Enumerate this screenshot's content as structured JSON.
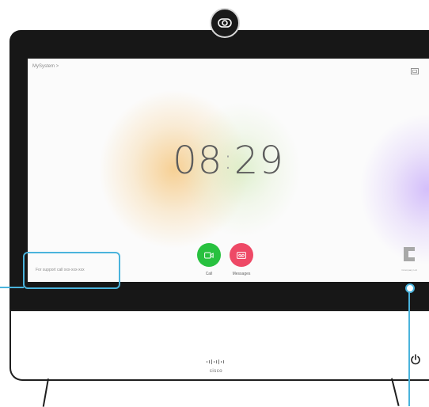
{
  "device": {
    "breadcrumb": "MySystem >",
    "clock": {
      "hours": "08",
      "separator": ":",
      "minutes": "29"
    },
    "support_text": "For support call xxx-xxx-xxx",
    "actions": [
      {
        "label": "Call",
        "icon": "video-camera-icon",
        "color": "#28c13f"
      },
      {
        "label": "Messages",
        "icon": "voicemail-icon",
        "color": "#ee4966"
      }
    ],
    "brand_caption": "Ccompany Ltd",
    "hardware_logo": "cisco",
    "accent_color": "#4ab3dc"
  }
}
